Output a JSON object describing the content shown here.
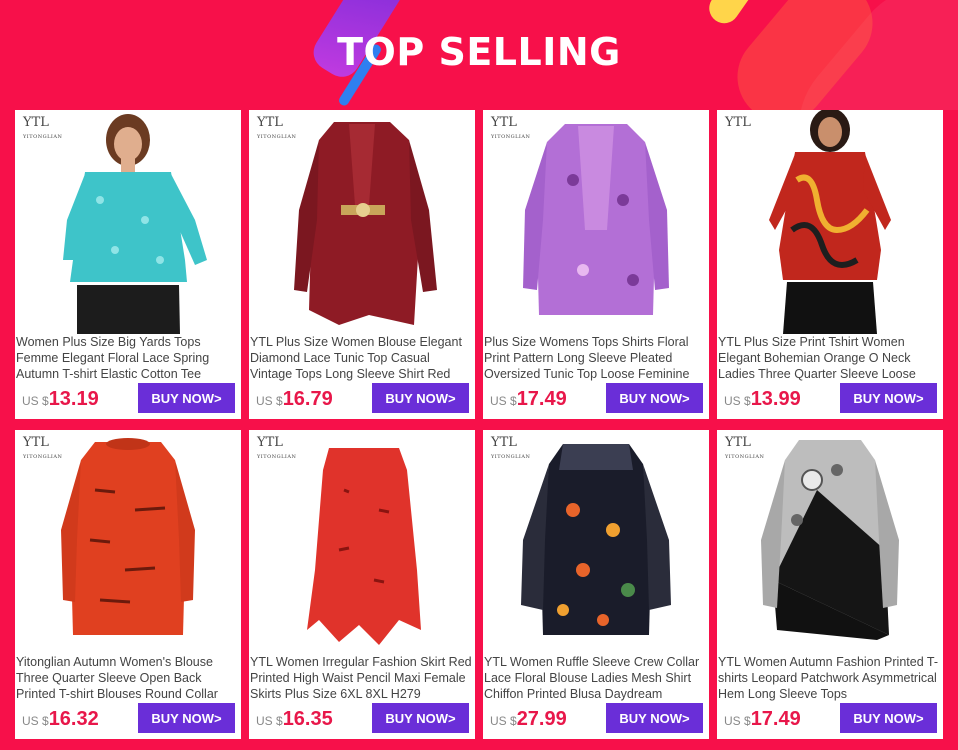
{
  "header": {
    "title": "TOP SELLING"
  },
  "colors": {
    "background": "#f7104a",
    "button": "#6a2ed8",
    "price": "#e8174a"
  },
  "products": [
    {
      "brand": "YTL",
      "brand_sub": "YITONGLIAN",
      "description": "Women Plus Size Big Yards Tops Femme Elegant Floral Lace Spring Autumn T-shirt Elastic Cotton Tee",
      "currency": "US $",
      "price": "13.19",
      "button": "BUY NOW>",
      "image": "turquoise-lace-top"
    },
    {
      "brand": "YTL",
      "brand_sub": "YITONGLIAN",
      "description": "YTL Plus Size Women Blouse Elegant Diamond Lace Tunic Top Casual Vintage Tops Long Sleeve Shirt Red",
      "currency": "US $",
      "price": "16.79",
      "button": "BUY NOW>",
      "image": "burgundy-lace-tunic"
    },
    {
      "brand": "YTL",
      "brand_sub": "YITONGLIAN",
      "description": "Plus Size Womens Tops Shirts Floral Print Pattern Long Sleeve Pleated Oversized Tunic Top Loose Feminine",
      "currency": "US $",
      "price": "17.49",
      "button": "BUY NOW>",
      "image": "purple-floral-tunic"
    },
    {
      "brand": "YTL",
      "brand_sub": "",
      "description": "YTL Plus Size Print Tshirt Women Elegant Bohemian Orange O Neck Ladies Three Quarter Sleeve Loose",
      "currency": "US $",
      "price": "13.99",
      "button": "BUY NOW>",
      "image": "orange-print-tshirt"
    },
    {
      "brand": "YTL",
      "brand_sub": "YITONGLIAN",
      "description": "Yitonglian Autumn Women's Blouse Three Quarter Sleeve Open Back Printed T-shirt Blouses Round Collar",
      "currency": "US $",
      "price": "16.32",
      "button": "BUY NOW>",
      "image": "red-printed-blouse"
    },
    {
      "brand": "YTL",
      "brand_sub": "YITONGLIAN",
      "description": "YTL Women Irregular Fashion Skirt Red Printed High Waist Pencil Maxi Female Skirts Plus Size 6XL 8XL H279",
      "currency": "US $",
      "price": "16.35",
      "button": "BUY NOW>",
      "image": "red-irregular-skirt"
    },
    {
      "brand": "YTL",
      "brand_sub": "YITONGLIAN",
      "description": "YTL Women Ruffle Sleeve Crew Collar Lace Floral Blouse Ladies Mesh Shirt Chiffon Printed Blusa Daydream",
      "currency": "US $",
      "price": "27.99",
      "button": "BUY NOW>",
      "image": "black-floral-mesh-blouse"
    },
    {
      "brand": "YTL",
      "brand_sub": "YITONGLIAN",
      "description": "YTL Women Autumn Fashion Printed T-shirts Leopard Patchwork Asymmetrical Hem Long Sleeve Tops",
      "currency": "US $",
      "price": "17.49",
      "button": "BUY NOW>",
      "image": "leopard-patchwork-top"
    }
  ]
}
